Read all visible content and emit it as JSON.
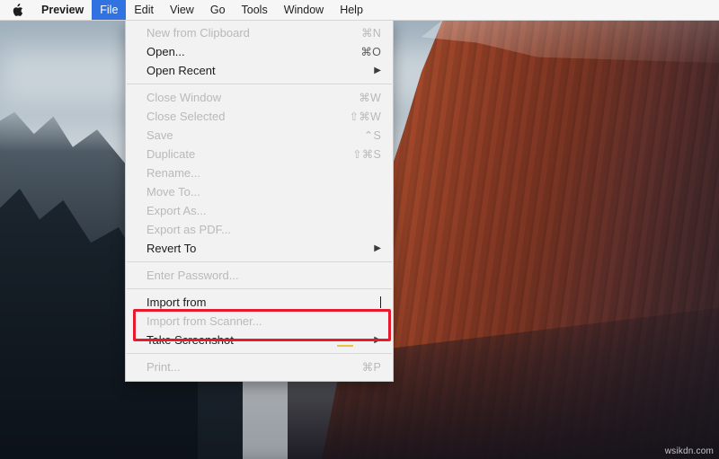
{
  "menubar": {
    "apple_icon": "apple-logo-icon",
    "items": [
      {
        "label": "Preview",
        "bold": true,
        "active": false
      },
      {
        "label": "File",
        "bold": false,
        "active": true
      },
      {
        "label": "Edit",
        "bold": false,
        "active": false
      },
      {
        "label": "View",
        "bold": false,
        "active": false
      },
      {
        "label": "Go",
        "bold": false,
        "active": false
      },
      {
        "label": "Tools",
        "bold": false,
        "active": false
      },
      {
        "label": "Window",
        "bold": false,
        "active": false
      },
      {
        "label": "Help",
        "bold": false,
        "active": false
      }
    ]
  },
  "file_menu": {
    "rows": [
      {
        "label": "New from Clipboard",
        "shortcut": "⌘N",
        "enabled": false,
        "submenu": false
      },
      {
        "label": "Open...",
        "shortcut": "⌘O",
        "enabled": true,
        "submenu": false
      },
      {
        "label": "Open Recent",
        "shortcut": "",
        "enabled": true,
        "submenu": true
      },
      {
        "separator": true
      },
      {
        "label": "Close Window",
        "shortcut": "⌘W",
        "enabled": false,
        "submenu": false
      },
      {
        "label": "Close Selected",
        "shortcut": "⇧⌘W",
        "enabled": false,
        "submenu": false
      },
      {
        "label": "Save",
        "shortcut": "⌃S",
        "enabled": false,
        "submenu": false
      },
      {
        "label": "Duplicate",
        "shortcut": "⇧⌘S",
        "enabled": false,
        "submenu": false
      },
      {
        "label": "Rename...",
        "shortcut": "",
        "enabled": false,
        "submenu": false
      },
      {
        "label": "Move To...",
        "shortcut": "",
        "enabled": false,
        "submenu": false
      },
      {
        "label": "Export As...",
        "shortcut": "",
        "enabled": false,
        "submenu": false
      },
      {
        "label": "Export as PDF...",
        "shortcut": "",
        "enabled": false,
        "submenu": false
      },
      {
        "label": "Revert To",
        "shortcut": "",
        "enabled": true,
        "submenu": true
      },
      {
        "separator": true
      },
      {
        "label": "Enter Password...",
        "shortcut": "",
        "enabled": false,
        "submenu": false
      },
      {
        "separator": true
      },
      {
        "label": "Import from",
        "shortcut": "",
        "enabled": true,
        "submenu": false,
        "highlighted": true
      },
      {
        "label": "Import from Scanner...",
        "shortcut": "",
        "enabled": false,
        "submenu": false
      },
      {
        "label": "Take Screenshot",
        "shortcut": "",
        "enabled": true,
        "submenu": true
      },
      {
        "separator": true
      },
      {
        "label": "Print...",
        "shortcut": "⌘P",
        "enabled": false,
        "submenu": false
      }
    ]
  },
  "annotations": {
    "highlight_color": "#e8192c",
    "watermark": "wsikdn.com"
  },
  "desktop": {
    "wallpaper_name": "el-capitan-cliff-wallpaper"
  }
}
